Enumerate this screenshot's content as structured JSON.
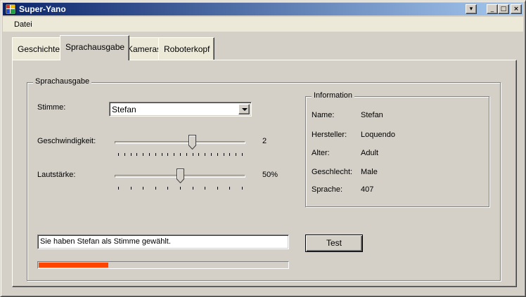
{
  "window": {
    "title": "Super-Yano",
    "buttons": {
      "menu": "▾",
      "minimize": "_",
      "maximize": "□",
      "close": "×"
    }
  },
  "menu": {
    "items": [
      {
        "label": "Datei"
      }
    ]
  },
  "tabs": [
    {
      "label": "Geschichte",
      "active": false
    },
    {
      "label": "Sprachausgabe",
      "active": true
    },
    {
      "label": "Kameras",
      "active": false
    },
    {
      "label": "Roboterkopf",
      "active": false
    }
  ],
  "speech": {
    "group_title": "Sprachausgabe",
    "voice_label": "Stimme:",
    "voice_value": "Stefan",
    "speed_label": "Geschwindigkeit:",
    "speed_value": "2",
    "speed_fraction": 0.6,
    "volume_label": "Lautstärke:",
    "volume_value": "50%",
    "volume_fraction": 0.5,
    "status_text": "Sie haben Stefan als Stimme gewählt.",
    "test_button": "Test",
    "progress_fraction": 0.28
  },
  "info": {
    "group_title": "Information",
    "rows": [
      {
        "label": "Name:",
        "value": "Stefan"
      },
      {
        "label": "Hersteller:",
        "value": "Loquendo"
      },
      {
        "label": "Alter:",
        "value": "Adult"
      },
      {
        "label": "Geschlecht:",
        "value": "Male"
      },
      {
        "label": "Sprache:",
        "value": "407"
      }
    ]
  },
  "colors": {
    "title_gradient_start": "#0a246a",
    "title_gradient_end": "#a6caf0",
    "face": "#d4d0c8",
    "progress": "#ff4500"
  }
}
